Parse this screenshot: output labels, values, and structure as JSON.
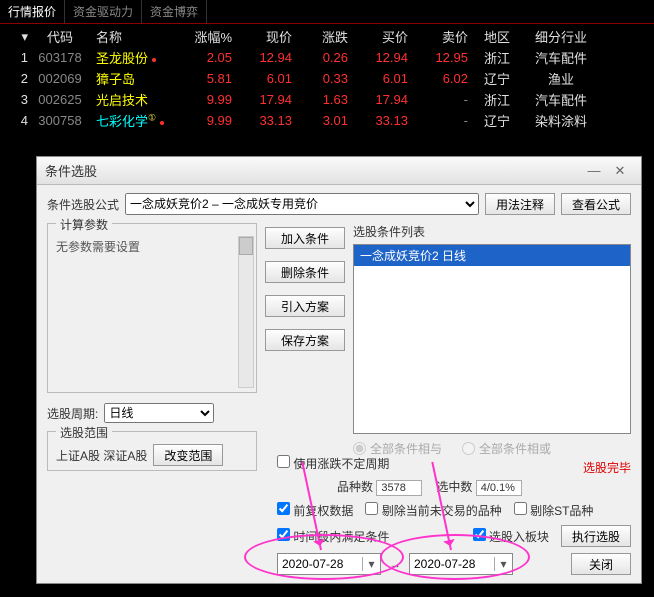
{
  "tabs": [
    "行情报价",
    "资金驱动力",
    "资金博弈"
  ],
  "headers": {
    "idx": "",
    "code": "代码",
    "name": "名称",
    "pct": "涨幅%",
    "price": "现价",
    "chg": "涨跌",
    "bid": "买价",
    "ask": "卖价",
    "region": "地区",
    "industry": "细分行业"
  },
  "rows": [
    {
      "idx": "1",
      "code": "603178",
      "name": "圣龙股份",
      "pct": "2.05",
      "price": "12.94",
      "chg": "0.26",
      "bid": "12.94",
      "ask": "12.95",
      "region": "浙江",
      "industry": "汽车配件",
      "nameClass": "yellow",
      "dot": true
    },
    {
      "idx": "2",
      "code": "002069",
      "name": "獐子岛",
      "pct": "5.81",
      "price": "6.01",
      "chg": "0.33",
      "bid": "6.01",
      "ask": "6.02",
      "region": "辽宁",
      "industry": "渔业",
      "nameClass": "yellow",
      "dot": false
    },
    {
      "idx": "3",
      "code": "002625",
      "name": "光启技术",
      "pct": "9.99",
      "price": "17.94",
      "chg": "1.63",
      "bid": "17.94",
      "ask": "-",
      "region": "浙江",
      "industry": "汽车配件",
      "nameClass": "yellow",
      "dot": false
    },
    {
      "idx": "4",
      "code": "300758",
      "name": "七彩化学",
      "pct": "9.99",
      "price": "33.13",
      "chg": "3.01",
      "bid": "33.13",
      "ask": "-",
      "region": "辽宁",
      "industry": "染料涂料",
      "nameClass": "cyan",
      "dot": true,
      "sup": "①"
    }
  ],
  "dialog": {
    "title": "条件选股",
    "formula_label": "条件选股公式",
    "formula_value": "一念成妖竞价2 – 一念成妖专用竞价",
    "btn_usage": "用法注释",
    "btn_view": "查看公式",
    "calc_legend": "计算参数",
    "calc_text": "无参数需要设置",
    "period_label": "选股周期:",
    "period_value": "日线",
    "btn_add": "加入条件",
    "btn_del": "删除条件",
    "btn_import": "引入方案",
    "btn_save": "保存方案",
    "cond_legend": "选股条件列表",
    "cond_item": "一念成妖竞价2  日线",
    "radio_and": "全部条件相与",
    "radio_or": "全部条件相或",
    "done_text": "选股完毕",
    "range_legend": "选股范围",
    "range_text": "上证A股 深证A股",
    "btn_range": "改变范围",
    "chk_period": "使用涨跌不定周期",
    "stat_kinds_label": "品种数",
    "stat_kinds_value": "3578",
    "stat_sel_label": "选中数",
    "stat_sel_value": "4/0.1%",
    "chk_fq": "前复权数据",
    "chk_rm": "剔除当前未交易的品种",
    "chk_st": "剔除ST品种",
    "chk_time": "时间段内满足条件",
    "chk_block": "选股入板块",
    "btn_run": "执行选股",
    "date_from": "2020-07-28",
    "date_to": "2020-07-28",
    "date_sep": "→",
    "btn_close": "关闭"
  }
}
